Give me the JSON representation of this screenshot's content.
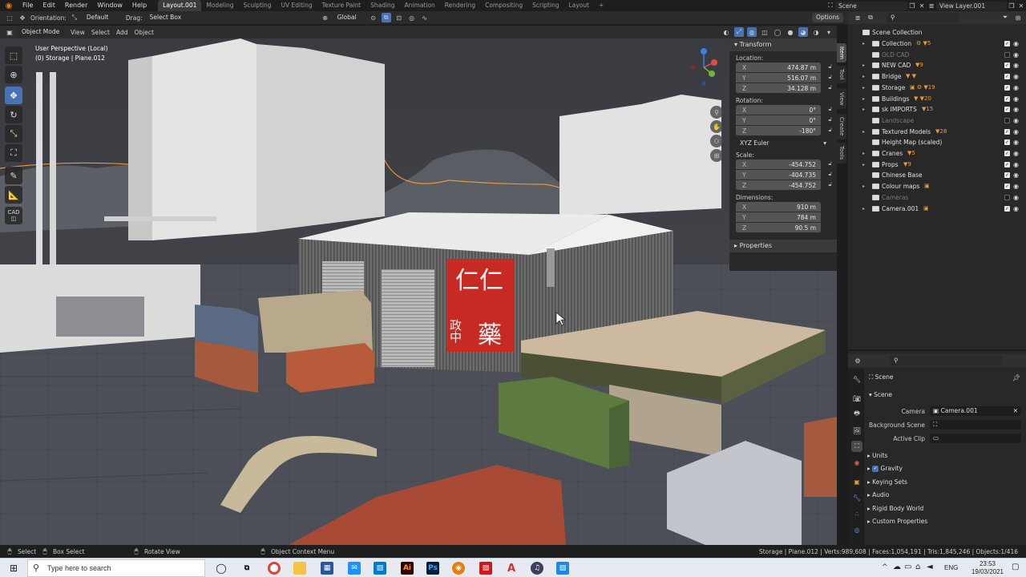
{
  "topbar": {
    "menus": [
      "File",
      "Edit",
      "Render",
      "Window",
      "Help"
    ],
    "workspace_tabs": [
      "Layout.001",
      "Modeling",
      "Sculpting",
      "UV Editing",
      "Texture Paint",
      "Shading",
      "Animation",
      "Rendering",
      "Compositing",
      "Scripting",
      "Layout"
    ],
    "active_tab": "Layout.001",
    "scene": "Scene",
    "view_layer": "View Layer.001"
  },
  "tool_header": {
    "orientation_label": "Orientation:",
    "orientation_value": "Default",
    "drag_label": "Drag:",
    "drag_value": "Select Box",
    "transform_orientation": "Global",
    "options": "Options"
  },
  "viewport_header": {
    "mode": "Object Mode",
    "menus": [
      "View",
      "Select",
      "Add",
      "Object"
    ]
  },
  "viewport": {
    "view_name": "User Perspective (Local)",
    "object_info": "(0) Storage | Plane.012"
  },
  "npanel": {
    "header": "Transform",
    "location_label": "Location:",
    "location": {
      "x": "474.87 m",
      "y": "516.07 m",
      "z": "34.128 m"
    },
    "rotation_label": "Rotation:",
    "rotation": {
      "x": "0°",
      "y": "0°",
      "z": "-180°"
    },
    "rotation_mode": "XYZ Euler",
    "scale_label": "Scale:",
    "scale": {
      "x": "-454.752",
      "y": "-404.735",
      "z": "-454.752"
    },
    "dimensions_label": "Dimensions:",
    "dimensions": {
      "x": "910 m",
      "y": "784 m",
      "z": "90.5 m"
    },
    "properties_header": "Properties",
    "axis_labels": [
      "X",
      "Y",
      "Z"
    ],
    "tabs": [
      "Item",
      "Tool",
      "View",
      "Create",
      "Tools"
    ]
  },
  "outliner": {
    "root": "Scene Collection",
    "items": [
      {
        "name": "Collection",
        "dim": false,
        "enabled": true,
        "badges": "⚙ ▼5"
      },
      {
        "name": "OLD CAD",
        "dim": true,
        "enabled": false,
        "badges": ""
      },
      {
        "name": "NEW CAD",
        "dim": false,
        "enabled": true,
        "badges": "▼9"
      },
      {
        "name": "Bridge",
        "dim": false,
        "enabled": true,
        "badges": "▼ ▼"
      },
      {
        "name": "Storage",
        "dim": false,
        "enabled": true,
        "badges": "▣ ⚙ ▼19"
      },
      {
        "name": "Buildings",
        "dim": false,
        "enabled": true,
        "badges": "▼ ▼20"
      },
      {
        "name": "sk IMPORTS",
        "dim": false,
        "enabled": true,
        "badges": "▼15"
      },
      {
        "name": "Landscape",
        "dim": true,
        "enabled": false,
        "badges": ""
      },
      {
        "name": "Textured Models",
        "dim": false,
        "enabled": true,
        "badges": "▼28"
      },
      {
        "name": "Height Map (scaled)",
        "dim": false,
        "enabled": true,
        "badges": ""
      },
      {
        "name": "Cranes",
        "dim": false,
        "enabled": true,
        "badges": "▼5"
      },
      {
        "name": "Props",
        "dim": false,
        "enabled": true,
        "badges": "▼9"
      },
      {
        "name": "Chinese Base",
        "dim": false,
        "enabled": true,
        "badges": ""
      },
      {
        "name": "Colour maps",
        "dim": false,
        "enabled": true,
        "badges": "▣"
      },
      {
        "name": "Cameras",
        "dim": true,
        "enabled": false,
        "badges": ""
      },
      {
        "name": "Camera.001",
        "dim": false,
        "enabled": true,
        "badges": "▣"
      }
    ]
  },
  "properties": {
    "context": "Scene",
    "panel": "Scene",
    "camera_label": "Camera",
    "camera_value": "Camera.001",
    "background_scene_label": "Background Scene",
    "active_clip_label": "Active Clip",
    "sections": [
      "Units",
      "Gravity",
      "Keying Sets",
      "Audio",
      "Rigid Body World",
      "Custom Properties"
    ],
    "gravity_checked": true
  },
  "statusbar": {
    "select": "Select",
    "box_select": "Box Select",
    "rotate_view": "Rotate View",
    "context_menu": "Object Context Menu",
    "stats": "Storage | Plane.012 | Verts:989,608 | Faces:1,054,191 | Tris:1,845,246 | Objects:1/416"
  },
  "taskbar": {
    "search_placeholder": "Type here to search",
    "language": "ENG",
    "time": "23:53",
    "date": "19/03/2021"
  },
  "sign": {
    "line1": "仁仁",
    "line2": "政中",
    "line3": "藥"
  },
  "colors": {
    "accent": "#4772b3",
    "blender_orange": "#e87d0d",
    "panel_bg": "#303030",
    "outliner_bg": "#282828"
  }
}
